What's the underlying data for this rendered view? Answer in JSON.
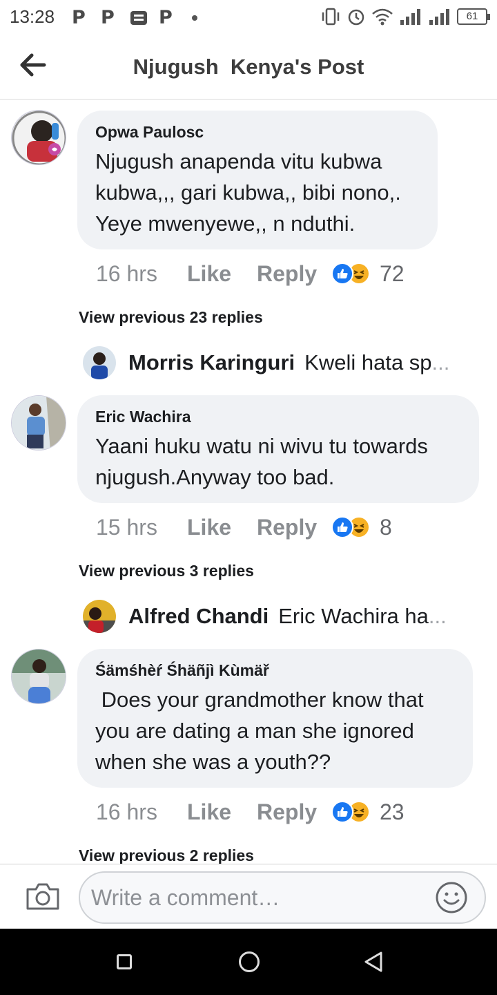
{
  "status_bar": {
    "time": "13:28",
    "notification_icons": [
      "P",
      "P",
      "message-icon",
      "P"
    ],
    "battery": "61"
  },
  "header": {
    "title": "Njugush  Kenya's Post"
  },
  "comments": [
    {
      "author": "Opwa Paulosc",
      "text": "Njugush anapenda vitu kubwa kubwa,,, gari kubwa,, bibi nono,. Yeye mwenyewe,, n nduthi.",
      "time": "16 hrs",
      "like_label": "Like",
      "reply_label": "Reply",
      "reaction_count": "72",
      "view_previous": "View previous 23 replies",
      "reply_preview": {
        "name": "Morris Karinguri",
        "snippet": "Kweli hata sp",
        "ellipsis": "..."
      }
    },
    {
      "author": "Eric Wachira",
      "text": "Yaani huku watu ni wivu tu towards njugush.Anyway too bad.",
      "time": "15 hrs",
      "like_label": "Like",
      "reply_label": "Reply",
      "reaction_count": "8",
      "view_previous": "View previous 3 replies",
      "reply_preview": {
        "name": "Alfred Chandi",
        "snippet": "Eric Wachira ha",
        "ellipsis": "..."
      }
    },
    {
      "author": "Śämśhèŕ Śhäñjì Kùmäř",
      "text": " Does your grandmother know that you are dating a man she ignored when she was a youth??",
      "time": "16 hrs",
      "like_label": "Like",
      "reply_label": "Reply",
      "reaction_count": "23",
      "view_previous": "View previous 2 replies"
    }
  ],
  "composer": {
    "placeholder": "Write a comment…"
  },
  "colors": {
    "bubble": "#f0f2f5",
    "like_blue": "#1877f2",
    "haha_yellow": "#f7b125",
    "muted_text": "#8a8d91"
  }
}
